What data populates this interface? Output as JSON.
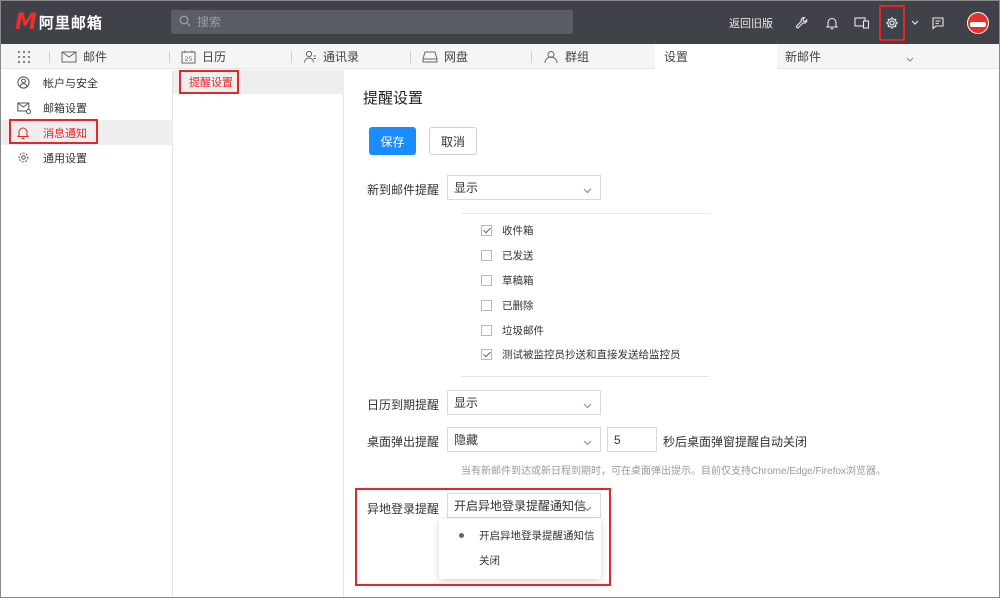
{
  "app": {
    "logo_letter": "M",
    "logo_text": "阿里邮箱",
    "brand_color": "#e8312a",
    "accent_color": "#1a8cff",
    "highlight_color": "#e3262a"
  },
  "topbar": {
    "search_placeholder": "搜索",
    "back_old_label": "返回旧版",
    "icons": [
      "wrench-icon",
      "bell-icon",
      "devices-icon",
      "gear-icon",
      "chevron-down-icon",
      "message-icon",
      "avatar"
    ]
  },
  "tabs": [
    {
      "label": "邮件",
      "icon": "mail-icon"
    },
    {
      "label": "日历",
      "icon": "calendar-icon",
      "icon_text": "25"
    },
    {
      "label": "通讯录",
      "icon": "contacts-icon"
    },
    {
      "label": "网盘",
      "icon": "disk-icon"
    },
    {
      "label": "群组",
      "icon": "group-icon"
    },
    {
      "label": "设置",
      "active": true
    },
    {
      "label": "新邮件"
    }
  ],
  "leftnav": {
    "items": [
      {
        "label": "帐户与安全",
        "icon": "user-icon"
      },
      {
        "label": "邮箱设置",
        "icon": "mail-settings-icon"
      },
      {
        "label": "消息通知",
        "icon": "bell-icon",
        "active": true
      },
      {
        "label": "通用设置",
        "icon": "gear-icon"
      }
    ]
  },
  "subnav": {
    "items": [
      {
        "label": "提醒设置",
        "active": true
      }
    ]
  },
  "main": {
    "title": "提醒设置",
    "save_label": "保存",
    "cancel_label": "取消",
    "new_mail": {
      "label": "新到邮件提醒",
      "value": "显示",
      "folders": [
        {
          "label": "收件箱",
          "checked": true
        },
        {
          "label": "已发送",
          "checked": false
        },
        {
          "label": "草稿箱",
          "checked": false
        },
        {
          "label": "已删除",
          "checked": false
        },
        {
          "label": "垃圾邮件",
          "checked": false
        },
        {
          "label": "测试被监控员抄送和直接发送给监控员",
          "checked": true
        }
      ]
    },
    "calendar": {
      "label": "日历到期提醒",
      "value": "显示"
    },
    "desktop": {
      "label": "桌面弹出提醒",
      "value": "隐藏",
      "seconds": "5",
      "suffix": "秒后桌面弹窗提醒自动关闭",
      "hint": "当有新邮件到达或新日程到期时，可在桌面弹出提示。目前仅支持Chrome/Edge/Firefox浏览器。"
    },
    "remote_login": {
      "label": "异地登录提醒",
      "value": "开启异地登录提醒通知信",
      "options": [
        {
          "label": "开启异地登录提醒通知信",
          "selected": true
        },
        {
          "label": "关闭",
          "selected": false
        }
      ]
    }
  }
}
